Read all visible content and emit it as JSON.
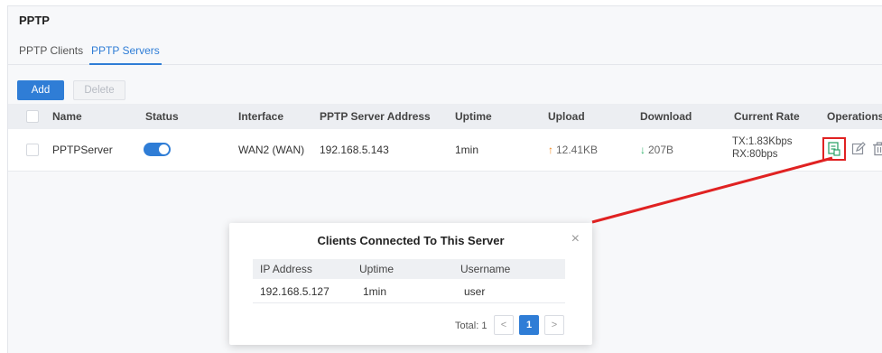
{
  "page": {
    "title": "PPTP"
  },
  "tabs": [
    {
      "label": "PPTP Clients",
      "active": false
    },
    {
      "label": "PPTP Servers",
      "active": true
    }
  ],
  "toolbar": {
    "add_label": "Add",
    "delete_label": "Delete"
  },
  "table": {
    "headers": {
      "name": "Name",
      "status": "Status",
      "interface": "Interface",
      "server_address": "PPTP Server Address",
      "uptime": "Uptime",
      "upload": "Upload",
      "download": "Download",
      "current_rate": "Current Rate",
      "operations": "Operations"
    },
    "rows": [
      {
        "name": "PPTPServer",
        "status_enabled": true,
        "interface": "WAN2 (WAN)",
        "server_address": "192.168.5.143",
        "uptime": "1min",
        "upload": "12.41KB",
        "download": "207B",
        "rate_tx": "TX:1.83Kbps",
        "rate_rx": "RX:80bps"
      }
    ]
  },
  "modal": {
    "title": "Clients Connected To This Server",
    "headers": {
      "ip": "IP Address",
      "uptime": "Uptime",
      "username": "Username"
    },
    "rows": [
      {
        "ip": "192.168.5.127",
        "uptime": "1min",
        "username": "user"
      }
    ],
    "total_label": "Total: 1",
    "current_page": "1",
    "prev_label": "<",
    "next_label": ">",
    "close_label": "×"
  },
  "colors": {
    "accent": "#2f7dd6",
    "highlight": "#e02222",
    "upload_arrow": "#f08a22",
    "download_arrow": "#2fb36b"
  },
  "icons": {
    "clients": "clients-list-icon",
    "edit": "edit-icon",
    "delete": "trash-icon",
    "upload": "arrow-up-icon",
    "download": "arrow-down-icon"
  }
}
